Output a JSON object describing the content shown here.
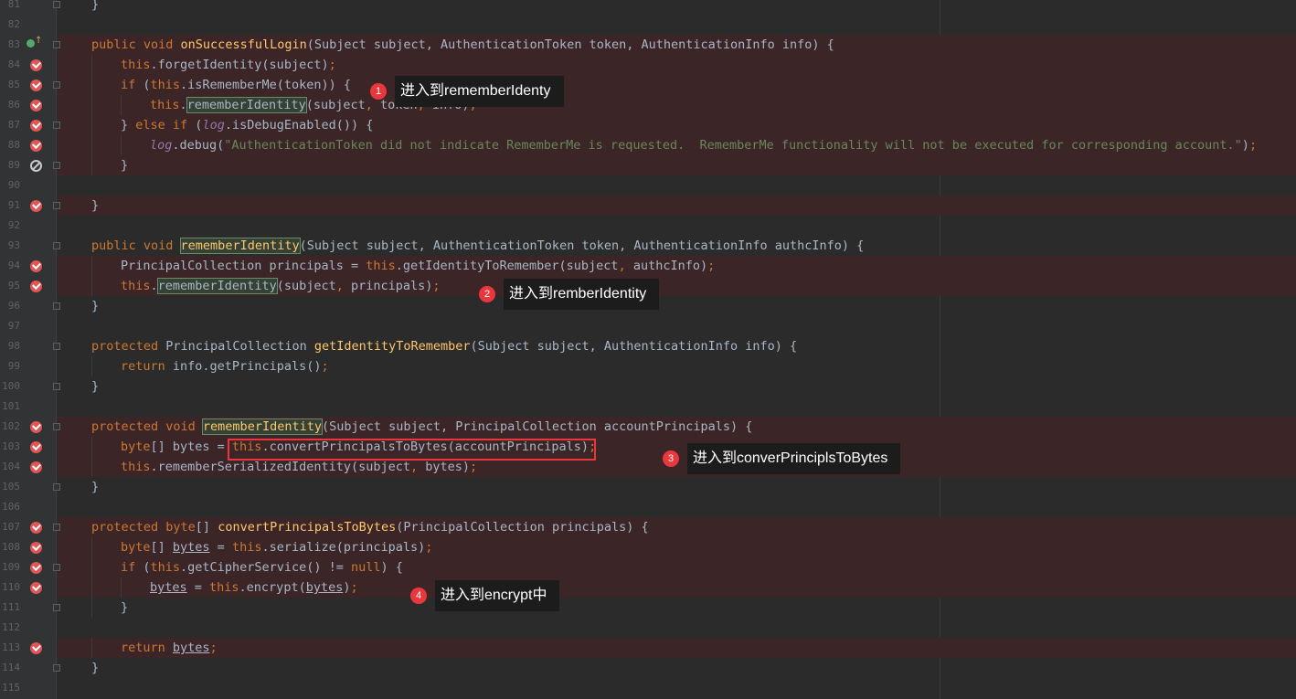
{
  "editor": {
    "lines": [
      {
        "num": "81",
        "bp": "",
        "fold": true,
        "indent": 0,
        "html": "<span>}</span>"
      },
      {
        "num": "82",
        "bp": "",
        "fold": false,
        "indent": 0,
        "html": ""
      },
      {
        "num": "83",
        "bp": "override",
        "fold": true,
        "indent": 0,
        "html": "<span class=\"kw\">public void </span><span class=\"fn\">onSuccessfulLogin</span>(Subject subject, AuthenticationToken token, AuthenticationInfo info) {"
      },
      {
        "num": "84",
        "bp": "on",
        "fold": false,
        "indent": 1,
        "html": "<span class=\"kw\">this</span>.forgetIdentity(subject)<span class=\"kw\">;</span>"
      },
      {
        "num": "85",
        "bp": "on",
        "fold": true,
        "indent": 1,
        "html": "<span class=\"kw\">if </span>(<span class=\"kw\">this</span>.isRememberMe(token)) {"
      },
      {
        "num": "86",
        "bp": "on",
        "fold": false,
        "indent": 2,
        "html": "<span class=\"kw\">this</span>.<span class=\"hl\">rememberIdentity</span>(subject<span class=\"kw\">, </span>token<span class=\"kw\">, </span>info)<span class=\"kw\">;</span>"
      },
      {
        "num": "87",
        "bp": "on",
        "fold": true,
        "indent": 1,
        "html": "} <span class=\"kw\">else if </span>(<span class=\"logv\">log</span>.isDebugEnabled()) {"
      },
      {
        "num": "88",
        "bp": "on",
        "fold": false,
        "indent": 2,
        "html": "<span class=\"logv\">log</span>.debug(<span class=\"str\">\"AuthenticationToken did not indicate RememberMe is requested.  RememberMe functionality will not be executed for corresponding account.\"</span>)<span class=\"kw\">;</span>"
      },
      {
        "num": "89",
        "bp": "off",
        "fold": true,
        "indent": 1,
        "html": "}"
      },
      {
        "num": "90",
        "bp": "",
        "fold": false,
        "indent": 0,
        "html": ""
      },
      {
        "num": "91",
        "bp": "on",
        "fold": true,
        "indent": 0,
        "html": "}"
      },
      {
        "num": "92",
        "bp": "",
        "fold": false,
        "indent": 0,
        "html": ""
      },
      {
        "num": "93",
        "bp": "",
        "fold": true,
        "indent": 0,
        "html": "<span class=\"kw\">public void </span><span class=\"fn hl\">rememberIdentity</span>(Subject subject, AuthenticationToken token, AuthenticationInfo authcInfo) {"
      },
      {
        "num": "94",
        "bp": "on",
        "fold": false,
        "indent": 1,
        "html": "PrincipalCollection principals = <span class=\"kw\">this</span>.getIdentityToRemember(subject<span class=\"kw\">, </span>authcInfo)<span class=\"kw\">;</span>"
      },
      {
        "num": "95",
        "bp": "on",
        "fold": false,
        "indent": 1,
        "html": "<span class=\"kw\">this</span>.<span class=\"hl\">rememberIdentity</span>(subject<span class=\"kw\">, </span>principals)<span class=\"kw\">;</span>"
      },
      {
        "num": "96",
        "bp": "",
        "fold": true,
        "indent": 0,
        "html": "}"
      },
      {
        "num": "97",
        "bp": "",
        "fold": false,
        "indent": 0,
        "html": ""
      },
      {
        "num": "98",
        "bp": "",
        "fold": true,
        "indent": 0,
        "html": "<span class=\"kw\">protected </span>PrincipalCollection <span class=\"fn\">getIdentityToRemember</span>(Subject subject, AuthenticationInfo info) {"
      },
      {
        "num": "99",
        "bp": "",
        "fold": false,
        "indent": 1,
        "html": "<span class=\"kw\">return </span>info.getPrincipals()<span class=\"kw\">;</span>"
      },
      {
        "num": "100",
        "bp": "",
        "fold": true,
        "indent": 0,
        "html": "}"
      },
      {
        "num": "101",
        "bp": "",
        "fold": false,
        "indent": 0,
        "html": ""
      },
      {
        "num": "102",
        "bp": "on",
        "fold": true,
        "indent": 0,
        "html": "<span class=\"kw\">protected void </span><span class=\"fn hl\">rememberIdentity</span>(Subject subject, PrincipalCollection accountPrincipals) {"
      },
      {
        "num": "103",
        "bp": "on",
        "fold": false,
        "indent": 1,
        "html": "<span class=\"kw\">byte</span>[] bytes = <span class=\"kw\">this</span>.convertPrincipalsToBytes(accountPrincipals)<span class=\"kw\">;</span>"
      },
      {
        "num": "104",
        "bp": "on",
        "fold": false,
        "indent": 1,
        "html": "<span class=\"kw\">this</span>.rememberSerializedIdentity(subject<span class=\"kw\">, </span>bytes)<span class=\"kw\">;</span>"
      },
      {
        "num": "105",
        "bp": "",
        "fold": true,
        "indent": 0,
        "html": "}"
      },
      {
        "num": "106",
        "bp": "",
        "fold": false,
        "indent": 0,
        "html": ""
      },
      {
        "num": "107",
        "bp": "on",
        "fold": true,
        "indent": 0,
        "html": "<span class=\"kw\">protected byte</span>[] <span class=\"fn\">convertPrincipalsToBytes</span>(PrincipalCollection principals) {"
      },
      {
        "num": "108",
        "bp": "on",
        "fold": false,
        "indent": 1,
        "html": "<span class=\"kw\">byte</span>[] <span class=\"under\">bytes</span> = <span class=\"kw\">this</span>.serialize(principals)<span class=\"kw\">;</span>"
      },
      {
        "num": "109",
        "bp": "on",
        "fold": true,
        "indent": 1,
        "html": "<span class=\"kw\">if </span>(<span class=\"kw\">this</span>.getCipherService() != <span class=\"kw\">null</span>) {"
      },
      {
        "num": "110",
        "bp": "on",
        "fold": false,
        "indent": 2,
        "html": "<span class=\"under\">bytes</span> = <span class=\"kw\">this</span>.encrypt(<span class=\"under\">bytes</span>)<span class=\"kw\">;</span>"
      },
      {
        "num": "111",
        "bp": "",
        "fold": true,
        "indent": 1,
        "html": "}"
      },
      {
        "num": "112",
        "bp": "",
        "fold": false,
        "indent": 0,
        "html": ""
      },
      {
        "num": "113",
        "bp": "on",
        "fold": false,
        "indent": 1,
        "html": "<span class=\"kw\">return </span><span class=\"under\">bytes</span><span class=\"kw\">;</span>"
      },
      {
        "num": "114",
        "bp": "",
        "fold": true,
        "indent": 0,
        "html": "}"
      },
      {
        "num": "115",
        "bp": "",
        "fold": false,
        "indent": 0,
        "html": ""
      }
    ]
  },
  "callouts": [
    {
      "badge": "1",
      "text": "进入到rememberIdenty"
    },
    {
      "badge": "2",
      "text": "进入到remberIdentity"
    },
    {
      "badge": "3",
      "text": "进入到converPrinciplsToBytes"
    },
    {
      "badge": "4",
      "text": "进入到encrypt中"
    }
  ],
  "colors": {
    "background": "#2b2b2b",
    "keyword": "#cc7832",
    "function": "#ffc66d",
    "string": "#6a8759",
    "breakpoint": "#e05555",
    "annotation": "#e8383d"
  }
}
